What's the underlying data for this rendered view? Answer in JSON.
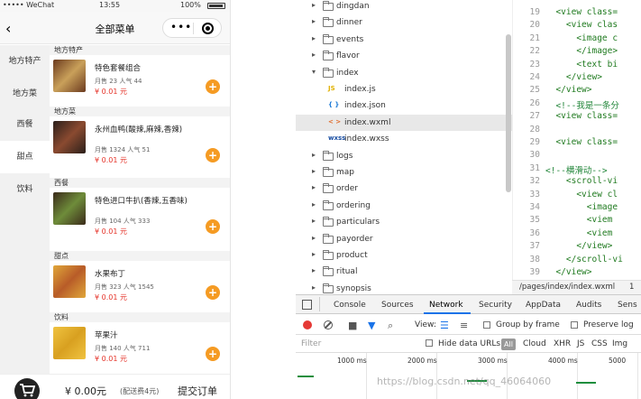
{
  "phone": {
    "status": {
      "carrier": "••••• WeChat",
      "time": "13:55",
      "battery": "100%"
    },
    "navbar": {
      "title": "全部菜单",
      "back": "‹"
    },
    "sidebar": [
      {
        "label": "地方特产"
      },
      {
        "label": "地方菜"
      },
      {
        "label": "西餐"
      },
      {
        "label": "甜点",
        "active": true
      },
      {
        "label": "饮料"
      }
    ],
    "sections": [
      {
        "category": "地方特产",
        "name": "特色套餐组合",
        "sales": "月售 23 人气 44",
        "price": "¥ 0.01 元",
        "colors": [
          "#6b3a1f",
          "#c9a05a"
        ]
      },
      {
        "category": "地方菜",
        "name": "永州血鸭(酸辣,麻辣,香辣)",
        "sales": "月售 1324 人气 51",
        "price": "¥ 0.01 元",
        "colors": [
          "#2a1f1a",
          "#8a4a30"
        ]
      },
      {
        "category": "西餐",
        "name": "特色进口牛扒(香辣,五香味)",
        "sales": "月售 104 人气 333",
        "price": "¥ 0.01 元",
        "colors": [
          "#3b2a1a",
          "#6e8c3a"
        ]
      },
      {
        "category": "甜点",
        "name": "水果布丁",
        "sales": "月售 323 人气 1545",
        "price": "¥ 0.01 元",
        "colors": [
          "#e0a73a",
          "#b85c28"
        ]
      },
      {
        "category": "饮料",
        "name": "苹果汁",
        "sales": "月售 140 人气 711",
        "price": "¥ 0.01 元",
        "colors": [
          "#f0c340",
          "#d8a020"
        ]
      }
    ],
    "cart": {
      "total": "¥ 0.00元",
      "delivery": "(配送费4元)",
      "checkout": "提交订单"
    }
  },
  "filetree": [
    {
      "label": "dingdan",
      "type": "folder",
      "open": false
    },
    {
      "label": "dinner",
      "type": "folder",
      "open": false
    },
    {
      "label": "events",
      "type": "folder",
      "open": false
    },
    {
      "label": "flavor",
      "type": "folder",
      "open": false
    },
    {
      "label": "index",
      "type": "folder",
      "open": true
    },
    {
      "label": "index.js",
      "type": "file",
      "icon": "JS",
      "icon_color": "#e0b000"
    },
    {
      "label": "index.json",
      "type": "file",
      "icon": "{ }",
      "icon_color": "#1e7ad6"
    },
    {
      "label": "index.wxml",
      "type": "file",
      "icon": "< >",
      "icon_color": "#e06b2b",
      "selected": true
    },
    {
      "label": "index.wxss",
      "type": "file",
      "icon": "wxss",
      "icon_color": "#1a4fa3"
    },
    {
      "label": "logs",
      "type": "folder",
      "open": false
    },
    {
      "label": "map",
      "type": "folder",
      "open": false
    },
    {
      "label": "order",
      "type": "folder",
      "open": false
    },
    {
      "label": "ordering",
      "type": "folder",
      "open": false
    },
    {
      "label": "particulars",
      "type": "folder",
      "open": false
    },
    {
      "label": "payorder",
      "type": "folder",
      "open": false
    },
    {
      "label": "product",
      "type": "folder",
      "open": false
    },
    {
      "label": "ritual",
      "type": "folder",
      "open": false
    },
    {
      "label": "synopsis",
      "type": "folder",
      "open": false
    }
  ],
  "code": [
    {
      "n": "19",
      "t": "  <view class=",
      "k": "tg"
    },
    {
      "n": "20",
      "t": "    <view clas",
      "k": "tg"
    },
    {
      "n": "21",
      "t": "      <image c",
      "k": "tg"
    },
    {
      "n": "22",
      "t": "      </image>",
      "k": "tg"
    },
    {
      "n": "23",
      "t": "      <text bi",
      "k": "tg"
    },
    {
      "n": "24",
      "t": "    </view>",
      "k": "tg"
    },
    {
      "n": "25",
      "t": "  </view>",
      "k": "tg"
    },
    {
      "n": "26",
      "t": "  <!--我是一条分",
      "k": "cm"
    },
    {
      "n": "27",
      "t": "  <view class=",
      "k": "tg"
    },
    {
      "n": "28",
      "t": "",
      "k": "tg"
    },
    {
      "n": "29",
      "t": "  <view class=",
      "k": "tg"
    },
    {
      "n": "30",
      "t": "",
      "k": "tg"
    },
    {
      "n": "31",
      "t": "<!--横滑动-->",
      "k": "cm"
    },
    {
      "n": "32",
      "t": "    <scroll-vi",
      "k": "tg"
    },
    {
      "n": "33",
      "t": "      <view cl",
      "k": "tg"
    },
    {
      "n": "34",
      "t": "        <image",
      "k": "tg"
    },
    {
      "n": "35",
      "t": "        <viem ",
      "k": "tg"
    },
    {
      "n": "36",
      "t": "        <viem ",
      "k": "tg"
    },
    {
      "n": "37",
      "t": "      </view>",
      "k": "tg"
    },
    {
      "n": "38",
      "t": "    </scroll-vi",
      "k": "tg"
    },
    {
      "n": "39",
      "t": "  </view>",
      "k": "tg"
    }
  ],
  "pathbar": {
    "path": "/pages/index/index.wxml",
    "extra": "1"
  },
  "devtools": {
    "tabs": [
      "Console",
      "Sources",
      "Network",
      "Security",
      "AppData",
      "Audits",
      "Sens"
    ],
    "active_tab": "Network",
    "toolbar": {
      "view_label": "View:",
      "group_label": "Group by frame",
      "preserve_label": "Preserve log"
    },
    "filter": {
      "placeholder": "Filter",
      "hide_data_urls": "Hide data URLs",
      "all": "All",
      "types": [
        "Cloud",
        "XHR",
        "JS",
        "CSS",
        "Img"
      ]
    },
    "ticks": [
      "1000 ms",
      "2000 ms",
      "3000 ms",
      "4000 ms",
      "5000"
    ]
  },
  "watermark": "https://blog.csdn.net/qq_46064060"
}
